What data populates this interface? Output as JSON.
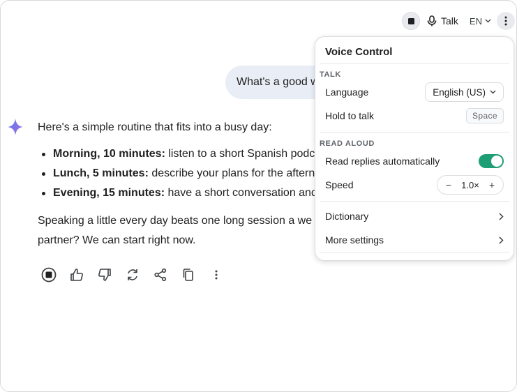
{
  "toolbar": {
    "talk_label": "Talk",
    "language_code": "EN"
  },
  "conversation": {
    "user_message": "What's a good w",
    "reply": {
      "intro": "Here's a simple routine that fits into a busy day:",
      "items": [
        {
          "bold": "Morning, 10 minutes:",
          "text": " listen to a short Spanish podc"
        },
        {
          "bold": "Lunch, 5 minutes:",
          "text": " describe your plans for the aftern"
        },
        {
          "bold": "Evening, 15 minutes:",
          "text": " have a short conversation and"
        }
      ],
      "outro_line1": "Speaking a little every day beats one long session a we",
      "outro_line2": "partner? We can start right now."
    }
  },
  "voice_control": {
    "title": "Voice Control",
    "talk_section": "TALK",
    "language_label": "Language",
    "language_value": "English (US)",
    "hold_label": "Hold to talk",
    "hold_key": "Space",
    "read_aloud_section": "READ ALOUD",
    "auto_read_label": "Read replies automatically",
    "auto_read_enabled": true,
    "speed_label": "Speed",
    "speed_value": "1.0×",
    "speed_minus": "−",
    "speed_plus": "+",
    "dictionary_label": "Dictionary",
    "more_settings_label": "More settings"
  },
  "colors": {
    "accent_toggle": "#1e9e74",
    "user_bubble": "#e9eef6",
    "spark_gradient_start": "#4e7cf5",
    "spark_gradient_end": "#b06ad8"
  }
}
